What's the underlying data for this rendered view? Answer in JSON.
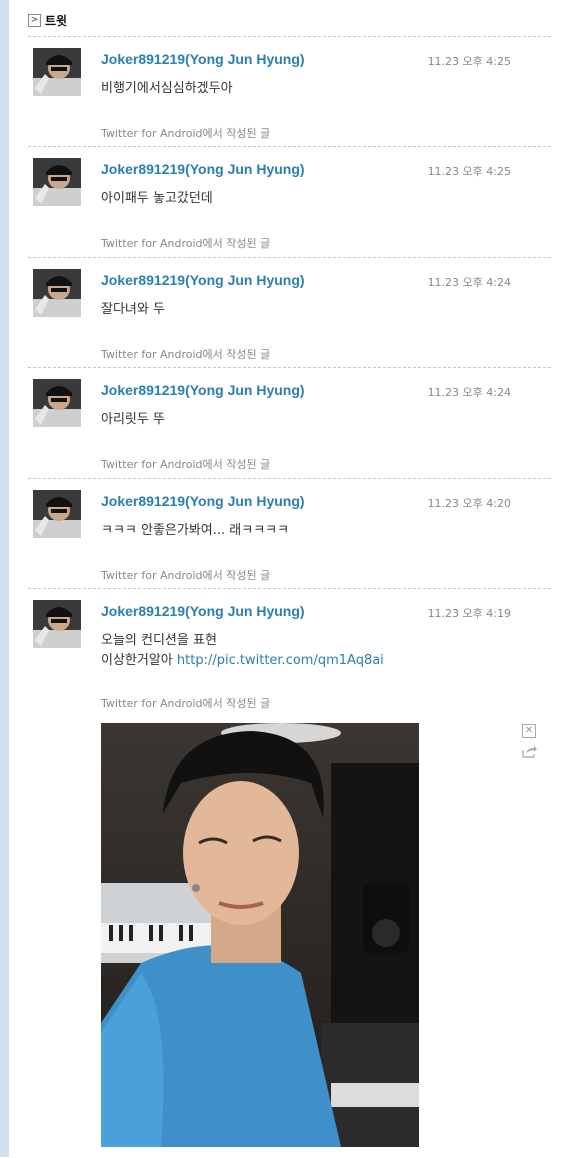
{
  "header": {
    "title": "트윗",
    "toggle_icon": "chevron-right-icon"
  },
  "tweets": [
    {
      "author": "Joker891219(Yong Jun Hyung)",
      "time": "11.23 오후 4:25",
      "text": "비행기에서심심하겠두아",
      "source": "Twitter for Android에서 작성된 글"
    },
    {
      "author": "Joker891219(Yong Jun Hyung)",
      "time": "11.23 오후 4:25",
      "text": "아이패두 놓고갔던데",
      "source": "Twitter for Android에서 작성된 글"
    },
    {
      "author": "Joker891219(Yong Jun Hyung)",
      "time": "11.23 오후 4:24",
      "text": "잘다녀와 두",
      "source": "Twitter for Android에서 작성된 글"
    },
    {
      "author": "Joker891219(Yong Jun Hyung)",
      "time": "11.23 오후 4:24",
      "text": "아리릿두 뚜",
      "source": "Twitter for Android에서 작성된 글"
    },
    {
      "author": "Joker891219(Yong Jun Hyung)",
      "time": "11.23 오후 4:20",
      "text": "ㅋㅋㅋ 안좋은가봐여... 래ㅋㅋㅋㅋ",
      "source": "Twitter for Android에서 작성된 글"
    },
    {
      "author": "Joker891219(Yong Jun Hyung)",
      "time": "11.23 오후 4:19",
      "text_line1": "오늘의 컨디션을 표현",
      "text_line2": "이상한거알아",
      "link": "http://pic.twitter.com/qm1Aq8ai",
      "source": "Twitter for Android에서 작성된 글"
    }
  ],
  "photo": {
    "close_icon": "close-icon",
    "share_icon": "share-icon"
  },
  "colors": {
    "author": "#2a7fb1",
    "link": "#2a7fb1",
    "muted": "#888888",
    "sidebar": "#cfe1ee"
  }
}
